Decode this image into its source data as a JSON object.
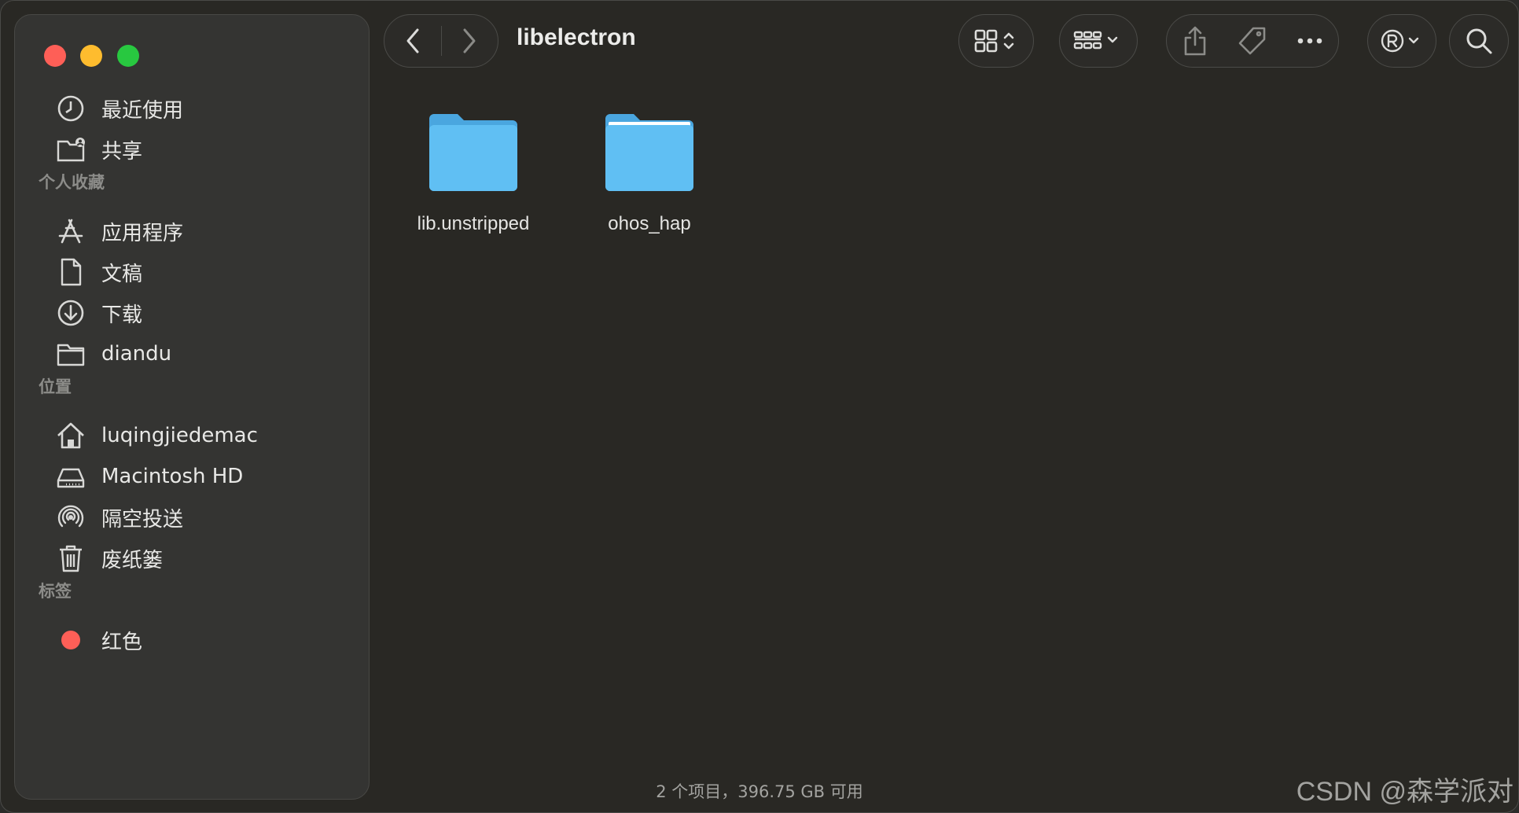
{
  "window": {
    "title": "libelectron",
    "status_text": "2 个项目，396.75 GB 可用"
  },
  "sidebar": {
    "recent": [
      {
        "label": "最近使用",
        "icon": "clock-icon"
      },
      {
        "label": "共享",
        "icon": "shared-folder-icon"
      }
    ],
    "favorites_header": "个人收藏",
    "favorites": [
      {
        "label": "应用程序",
        "icon": "applications-icon"
      },
      {
        "label": "文稿",
        "icon": "document-icon"
      },
      {
        "label": "下载",
        "icon": "download-icon"
      },
      {
        "label": "diandu",
        "icon": "folder-icon"
      }
    ],
    "locations_header": "位置",
    "locations": [
      {
        "label": "luqingjiedemac",
        "icon": "home-icon"
      },
      {
        "label": "Macintosh HD",
        "icon": "drive-icon"
      },
      {
        "label": "隔空投送",
        "icon": "airdrop-icon"
      },
      {
        "label": "废纸篓",
        "icon": "trash-icon"
      }
    ],
    "tags_header": "标签",
    "tags": [
      {
        "label": "红色",
        "color": "#fe5f57"
      }
    ]
  },
  "toolbar": {
    "icons": [
      "back-icon",
      "forward-icon",
      "icon-view-icon",
      "group-icon",
      "share-icon",
      "tag-icon",
      "more-icon",
      "registered-icon",
      "search-icon"
    ]
  },
  "files": [
    {
      "name": "lib.unstripped",
      "icon": "folder-icon"
    },
    {
      "name": "ohos_hap",
      "icon": "folder-icon"
    }
  ],
  "watermark": "CSDN @森学派对",
  "colors": {
    "accent_folder": "#5cb9f0",
    "traffic_red": "#fe5f57",
    "traffic_yellow": "#febc2e",
    "traffic_green": "#28c840"
  }
}
